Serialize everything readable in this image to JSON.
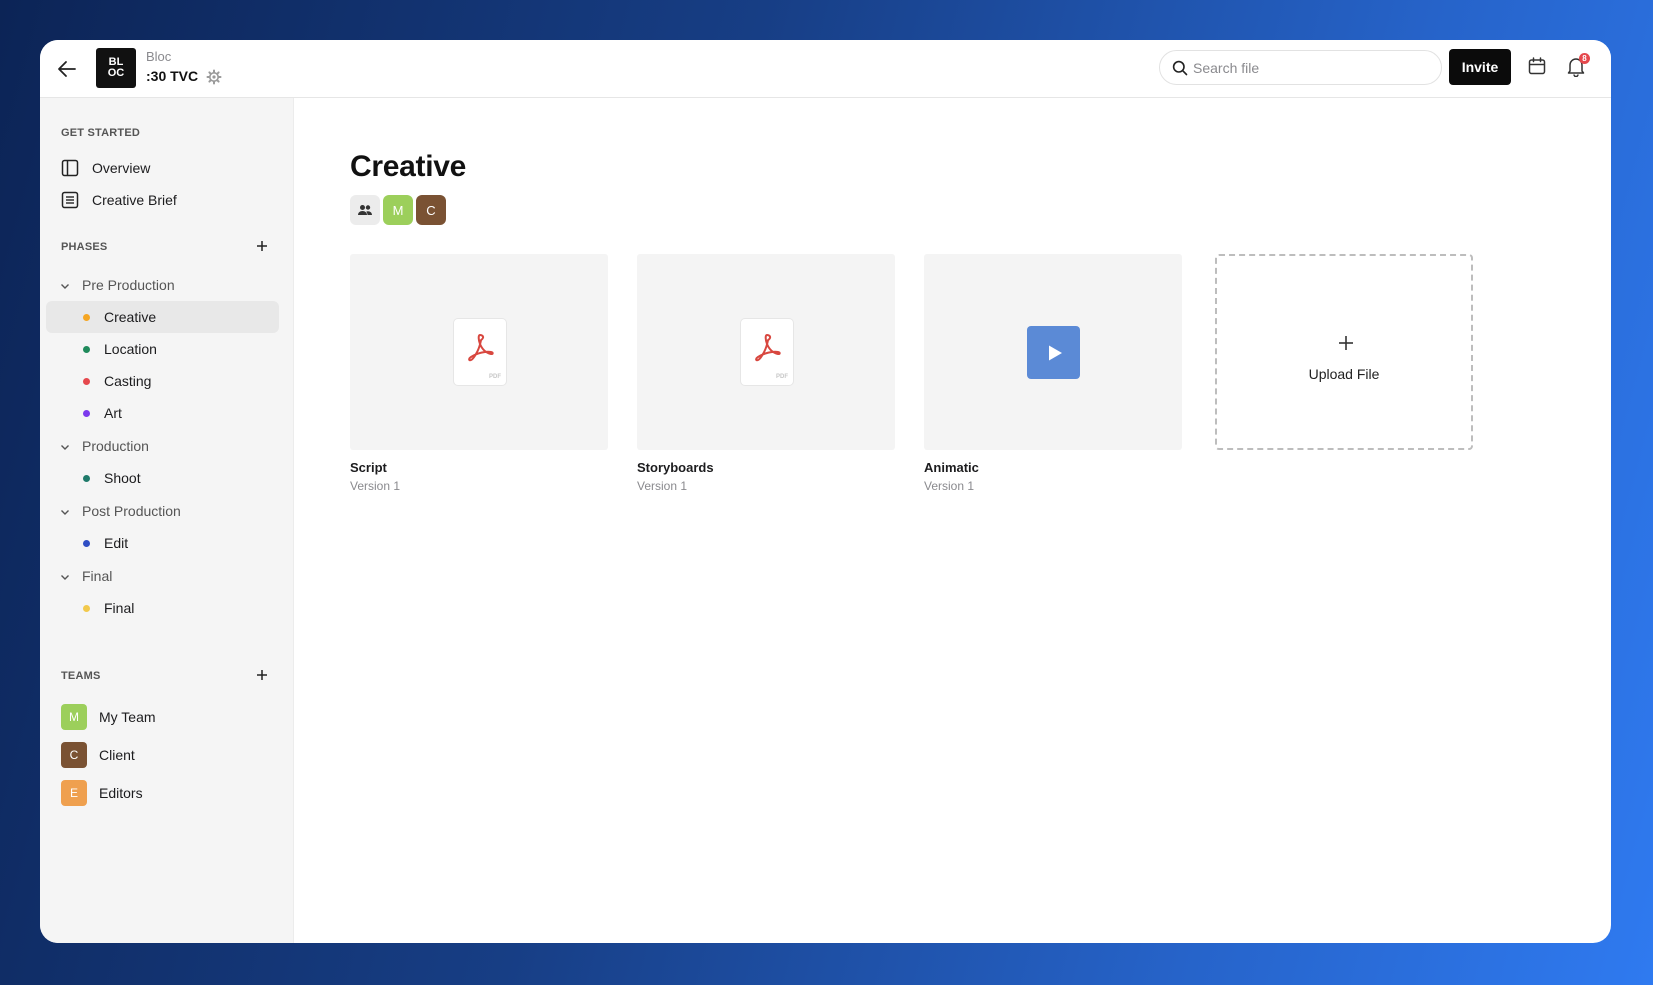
{
  "header": {
    "logo_text": "BL\nOC",
    "org_name": "Bloc",
    "project_name": ":30 TVC",
    "search_placeholder": "Search file",
    "invite_label": "Invite",
    "notification_count": "8"
  },
  "sidebar": {
    "get_started_title": "GET STARTED",
    "get_started": [
      {
        "label": "Overview",
        "icon": "panel-icon"
      },
      {
        "label": "Creative Brief",
        "icon": "document-icon"
      }
    ],
    "phases_title": "PHASES",
    "phase_groups": [
      {
        "label": "Pre Production",
        "items": [
          {
            "label": "Creative",
            "color": "#f5a623",
            "active": true
          },
          {
            "label": "Location",
            "color": "#1f8a5b"
          },
          {
            "label": "Casting",
            "color": "#e5484d"
          },
          {
            "label": "Art",
            "color": "#7c3aed"
          }
        ]
      },
      {
        "label": "Production",
        "items": [
          {
            "label": "Shoot",
            "color": "#1f7a6a"
          }
        ]
      },
      {
        "label": "Post Production",
        "items": [
          {
            "label": "Edit",
            "color": "#2f4ec4"
          }
        ]
      },
      {
        "label": "Final",
        "items": [
          {
            "label": "Final",
            "color": "#f2c94c"
          }
        ]
      }
    ],
    "teams_title": "TEAMS",
    "teams": [
      {
        "initial": "M",
        "label": "My Team",
        "color": "#9ccf5b"
      },
      {
        "initial": "C",
        "label": "Client",
        "color": "#7a5233"
      },
      {
        "initial": "E",
        "label": "Editors",
        "color": "#efa04f"
      }
    ]
  },
  "main": {
    "title": "Creative",
    "members": [
      {
        "initial": "M",
        "color": "#9ccf5b"
      },
      {
        "initial": "C",
        "color": "#7a5233"
      }
    ],
    "files": [
      {
        "name": "Script",
        "version": "Version 1",
        "type": "pdf"
      },
      {
        "name": "Storyboards",
        "version": "Version 1",
        "type": "pdf"
      },
      {
        "name": "Animatic",
        "version": "Version 1",
        "type": "video"
      }
    ],
    "pdf_badge": "PDF",
    "upload_label": "Upload File"
  }
}
